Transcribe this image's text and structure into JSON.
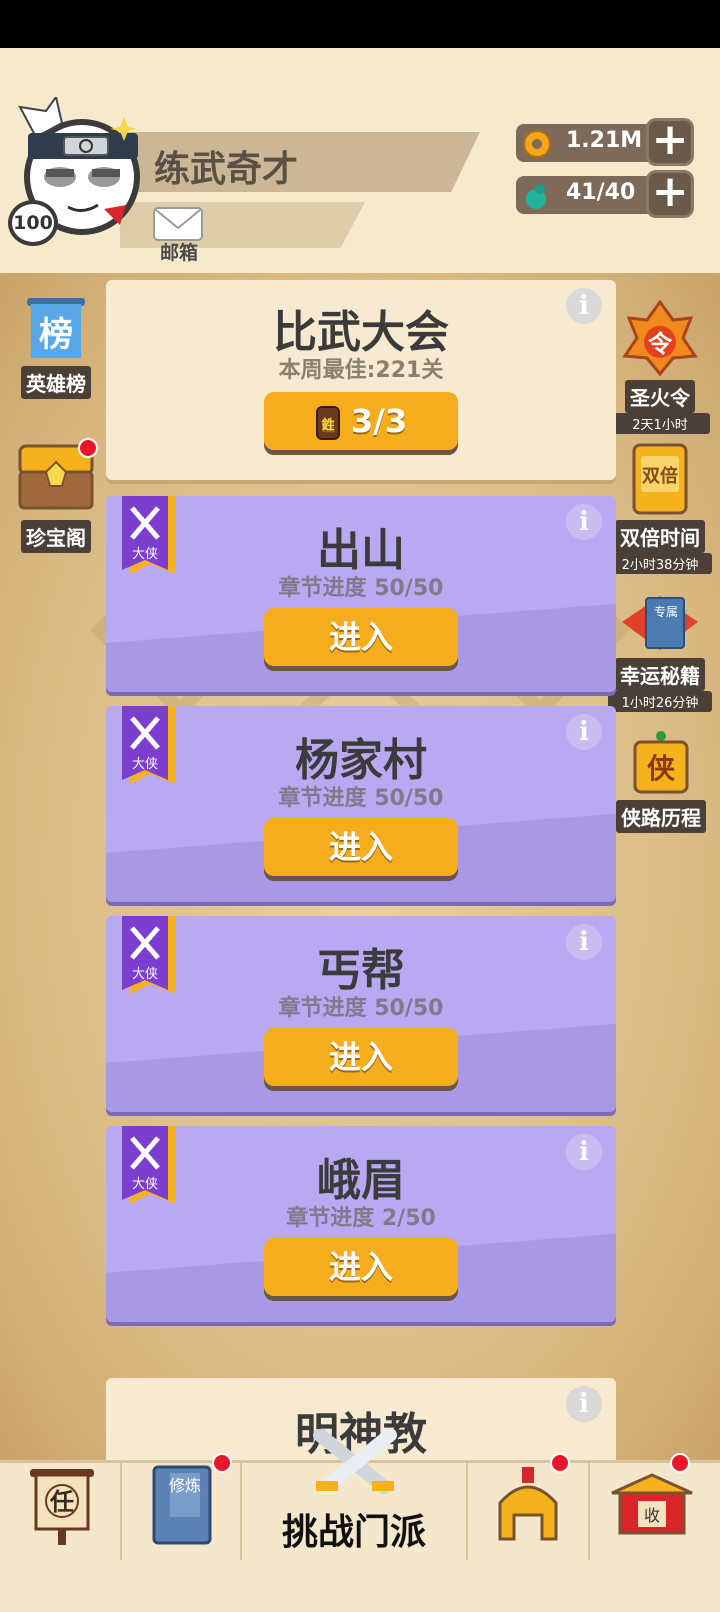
{
  "player": {
    "name": "练武奇才",
    "level": "100",
    "mail_label": "邮箱"
  },
  "resources": {
    "coins": "1.21M",
    "energy": "41/40"
  },
  "side_left": [
    {
      "label": "英雄榜",
      "icon_text": "榜"
    },
    {
      "label": "珍宝阁"
    }
  ],
  "side_right": [
    {
      "label": "圣火令",
      "sub": "2天1小时",
      "icon_text": "令"
    },
    {
      "label": "双倍时间",
      "sub": "2小时38分钟",
      "icon_text": "双倍"
    },
    {
      "label": "幸运秘籍",
      "sub": "1小时26分钟",
      "icon_text": "专属"
    },
    {
      "label": "侠路历程",
      "icon_text": "侠"
    }
  ],
  "event_card": {
    "title": "比武大会",
    "best": "本周最佳:221关",
    "tickets": "3/3",
    "ticket_icon_text": "鉎"
  },
  "chapters": [
    {
      "title": "出山",
      "progress": "章节进度 50/50",
      "button": "进入",
      "badge": "大侠"
    },
    {
      "title": "杨家村",
      "progress": "章节进度 50/50",
      "button": "进入",
      "badge": "大侠"
    },
    {
      "title": "丐帮",
      "progress": "章节进度 50/50",
      "button": "进入",
      "badge": "大侠"
    },
    {
      "title": "峨眉",
      "progress": "章节进度 2/50",
      "button": "进入",
      "badge": "大侠"
    }
  ],
  "locked_card": {
    "title": "明神教"
  },
  "bottom_nav": {
    "task_icon_text": "任",
    "train_icon_text": "修炼",
    "challenge_label": "挑战门派",
    "collect_icon_text": "收"
  },
  "info_glyph": "i"
}
